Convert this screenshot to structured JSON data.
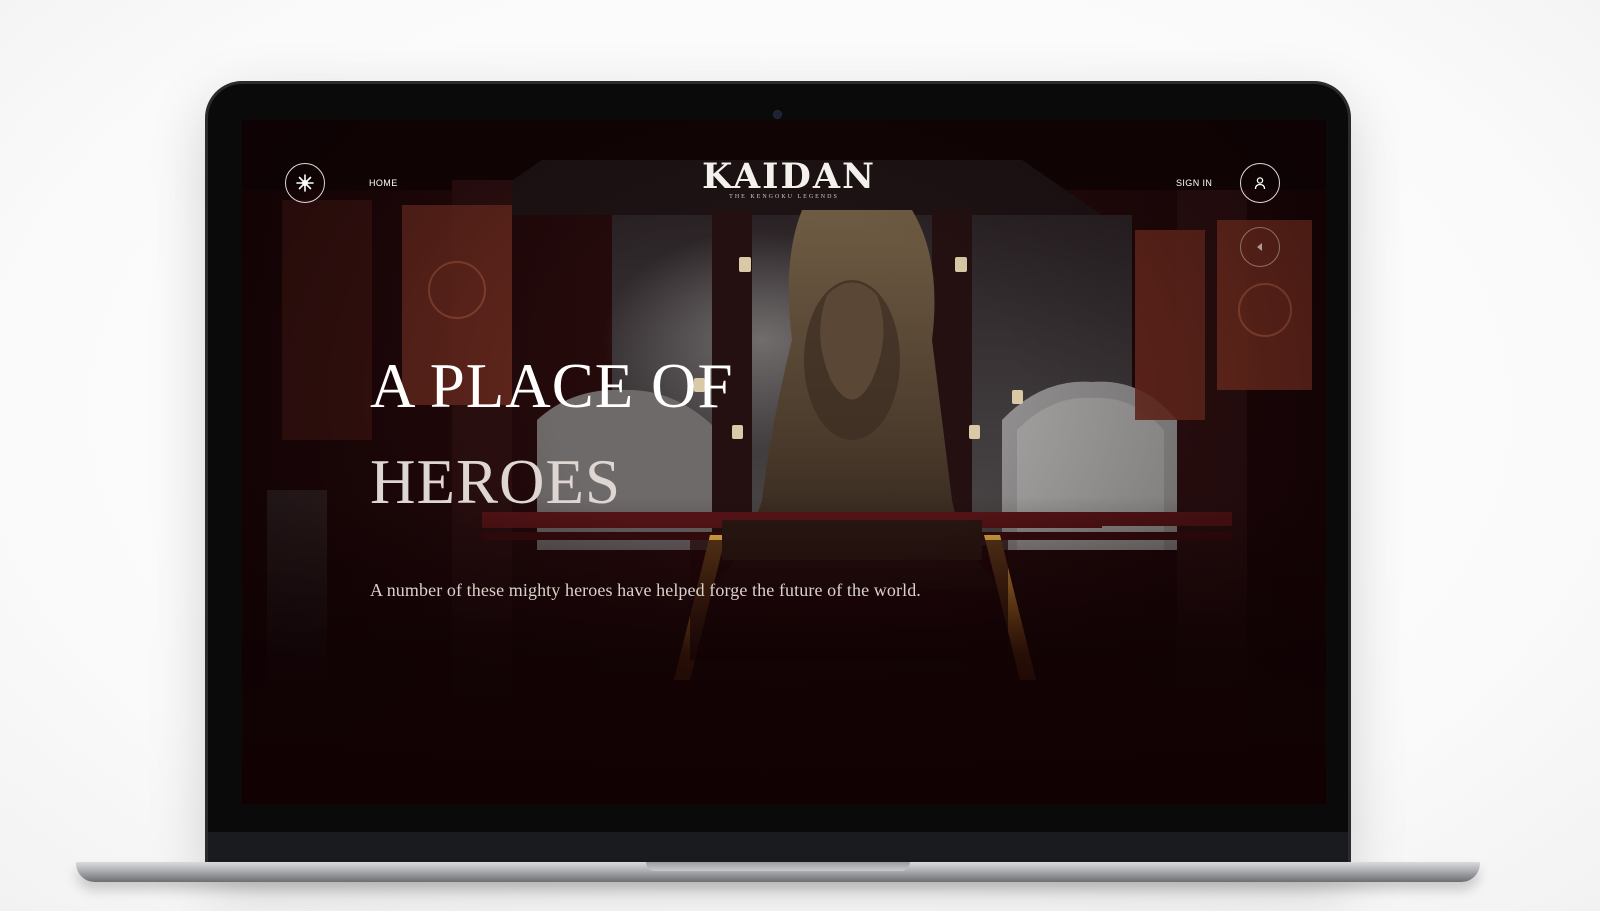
{
  "site": {
    "logo_title": "KAIDAN",
    "logo_subtitle": "THE KENGOKU LEGENDS"
  },
  "nav": {
    "home_label": "HOME",
    "sign_in_label": "SIGN IN"
  },
  "hero": {
    "headline_line1": "A PLACE OF",
    "headline_line2": "HEROES",
    "subline": "A number of these mighty heroes have helped forge the future of the world."
  },
  "icons": {
    "menu": "emblem-menu-icon",
    "account": "user-icon",
    "sound": "speaker-icon"
  },
  "colors": {
    "background_dark": "#150507",
    "banner_red": "#6e2418",
    "lava_glow": "#f0a52c",
    "text_primary": "#ffffff"
  }
}
